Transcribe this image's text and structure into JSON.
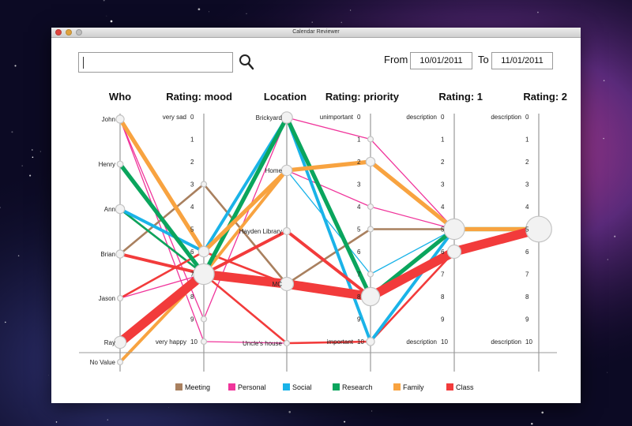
{
  "window": {
    "title": "Calendar Reviewer"
  },
  "search": {
    "value": "",
    "placeholder": ""
  },
  "date_range": {
    "from_label": "From",
    "from_value": "10/01/2011",
    "to_label": "To",
    "to_value": "11/01/2011"
  },
  "chart_data": {
    "type": "parallel_coordinates",
    "axes": [
      {
        "key": "who",
        "title": "Who",
        "labels": [
          "John",
          "Henry",
          "Ann",
          "Brian",
          "Jason",
          "Ray",
          "No Value"
        ]
      },
      {
        "key": "mood",
        "title": "Rating: mood",
        "labels": [
          "0",
          "1",
          "2",
          "3",
          "4",
          "5",
          "6",
          "7",
          "8",
          "9",
          "10"
        ],
        "low_text": "very sad",
        "high_text": "very happy"
      },
      {
        "key": "location",
        "title": "Location",
        "labels": [
          "Brickyard",
          "Home",
          "Hayden Library",
          "MC",
          "Uncle's house"
        ]
      },
      {
        "key": "priority",
        "title": "Rating: priority",
        "labels": [
          "0",
          "1",
          "2",
          "3",
          "4",
          "5",
          "6",
          "7",
          "8",
          "9",
          "10"
        ],
        "low_text": "unimportant",
        "high_text": "important"
      },
      {
        "key": "r1",
        "title": "Rating: 1",
        "labels": [
          "0",
          "1",
          "2",
          "3",
          "4",
          "5",
          "6",
          "7",
          "8",
          "9",
          "10"
        ],
        "low_text": "description",
        "high_text": "description"
      },
      {
        "key": "r2",
        "title": "Rating: 2",
        "labels": [
          "0",
          "1",
          "2",
          "3",
          "4",
          "5",
          "6",
          "7",
          "8",
          "9",
          "10"
        ],
        "low_text": "description",
        "high_text": "description"
      }
    ],
    "categories": [
      {
        "name": "Meeting",
        "color": "#a9805f"
      },
      {
        "name": "Personal",
        "color": "#f0359b"
      },
      {
        "name": "Social",
        "color": "#1ab3e8"
      },
      {
        "name": "Research",
        "color": "#0aa55d"
      },
      {
        "name": "Family",
        "color": "#f8a340"
      },
      {
        "name": "Class",
        "color": "#f23b3b"
      }
    ],
    "records": [
      {
        "category": "Meeting",
        "values": [
          "Brian",
          3,
          "MC",
          5,
          5,
          5
        ],
        "weight": 2
      },
      {
        "category": "Meeting",
        "values": [
          "Ann",
          7,
          "Hayden Library",
          8,
          5,
          5
        ],
        "weight": 2
      },
      {
        "category": "Personal",
        "values": [
          "John",
          9,
          "Brickyard",
          1,
          5,
          5
        ],
        "weight": 1
      },
      {
        "category": "Personal",
        "values": [
          "John",
          10,
          "Uncle's house",
          10,
          5,
          5
        ],
        "weight": 1
      },
      {
        "category": "Personal",
        "values": [
          "Jason",
          7,
          "Home",
          4,
          5,
          5
        ],
        "weight": 1
      },
      {
        "category": "Social",
        "values": [
          "Ann",
          6,
          "Brickyard",
          10,
          5,
          5
        ],
        "weight": 3
      },
      {
        "category": "Social",
        "values": [
          "Brian",
          7,
          "Home",
          7,
          5,
          5
        ],
        "weight": 1
      },
      {
        "category": "Research",
        "values": [
          "Henry",
          7,
          "Brickyard",
          8,
          5,
          5
        ],
        "weight": 4
      },
      {
        "category": "Research",
        "values": [
          "Ann",
          7,
          "Brickyard",
          8,
          5,
          5
        ],
        "weight": 2
      },
      {
        "category": "Family",
        "values": [
          "John",
          6,
          "Home",
          2,
          5,
          5
        ],
        "weight": 4
      },
      {
        "category": "Family",
        "values": [
          "No Value",
          7,
          "Home",
          2,
          5,
          5
        ],
        "weight": 3
      },
      {
        "category": "Class",
        "values": [
          "Ray",
          7,
          "MC",
          8,
          6,
          5
        ],
        "weight": 9
      },
      {
        "category": "Class",
        "values": [
          "Brian",
          7,
          "Hayden Library",
          8,
          5,
          5
        ],
        "weight": 3
      },
      {
        "category": "Class",
        "values": [
          "Jason",
          6,
          "MC",
          8,
          6,
          5
        ],
        "weight": 2
      },
      {
        "category": "Class",
        "values": [
          "Ray",
          7,
          "Uncle's house",
          10,
          6,
          5
        ],
        "weight": 2
      }
    ]
  }
}
